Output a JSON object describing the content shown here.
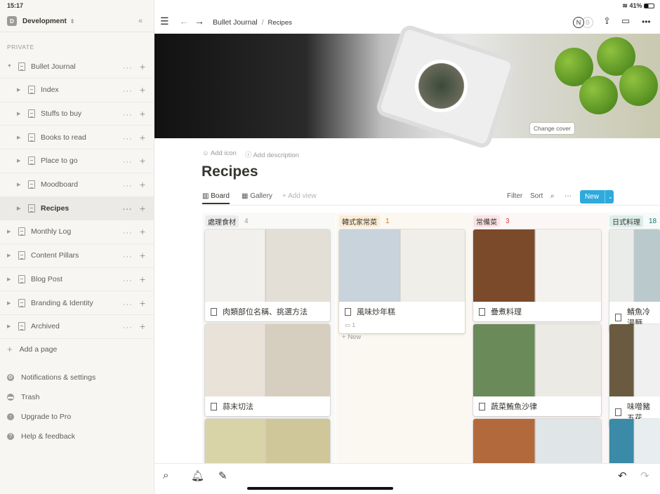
{
  "status": {
    "time": "15:17",
    "battery": "41%"
  },
  "workspace": {
    "name": "Development",
    "avatar": "D",
    "collapse_icon": "double-chevron-left-icon"
  },
  "sidebar": {
    "section": "PRIVATE",
    "items": [
      {
        "label": "Bullet Journal",
        "level": 0,
        "expanded": true
      },
      {
        "label": "Index",
        "level": 1
      },
      {
        "label": "Stuffs to buy",
        "level": 1
      },
      {
        "label": "Books to read",
        "level": 1
      },
      {
        "label": "Place to go",
        "level": 1
      },
      {
        "label": "Moodboard",
        "level": 1
      },
      {
        "label": "Recipes",
        "level": 1,
        "active": true
      },
      {
        "label": "Monthly Log",
        "level": 0
      },
      {
        "label": "Content Pillars",
        "level": 0
      },
      {
        "label": "Blog Post",
        "level": 0
      },
      {
        "label": "Branding & Identity",
        "level": 0
      },
      {
        "label": "Archived",
        "level": 0
      }
    ],
    "add_page": "Add a page",
    "bottom": [
      {
        "label": "Notifications & settings",
        "icon": "gear-icon"
      },
      {
        "label": "Trash",
        "icon": "trash-icon"
      },
      {
        "label": "Upgrade to Pro",
        "icon": "arrow-up-icon"
      },
      {
        "label": "Help & feedback",
        "icon": "question-icon"
      }
    ]
  },
  "header": {
    "breadcrumb": [
      "Bullet Journal",
      "Recipes"
    ],
    "avatars": [
      "N",
      "B"
    ]
  },
  "page": {
    "change_cover": "Change cover",
    "add_icon": "Add icon",
    "add_description": "Add description",
    "title": "Recipes"
  },
  "views": {
    "tabs": [
      "Board",
      "Gallery"
    ],
    "add_view": "Add view",
    "filter": "Filter",
    "sort": "Sort",
    "new": "New"
  },
  "board": {
    "add_new": "New",
    "columns": [
      {
        "name": "處理食材",
        "count": "4",
        "tag_bg": "#ebeced",
        "tag_color": "#37352f",
        "count_color": "#9b9a97",
        "bg": "#f9f9f8",
        "cards": [
          {
            "title": "肉類部位名稱、挑選方法"
          },
          {
            "title": "蒜末切法"
          },
          {
            "title": ""
          }
        ]
      },
      {
        "name": "韓式家常菜",
        "count": "1",
        "tag_bg": "#fbecd5",
        "tag_color": "#37352f",
        "count_color": "#d9730d",
        "bg": "#fbf8f1",
        "cards": [
          {
            "title": "風味炒年糕",
            "comments": "1"
          }
        ]
      },
      {
        "name": "常備菜",
        "count": "3",
        "tag_bg": "#fbe4e4",
        "tag_color": "#37352f",
        "count_color": "#e03e3e",
        "bg": "#fcf7f6",
        "cards": [
          {
            "title": "疊煮料理"
          },
          {
            "title": "蔬菜鮪魚沙律"
          },
          {
            "title": ""
          }
        ]
      },
      {
        "name": "日式料理",
        "count": "18",
        "tag_bg": "#ddedea",
        "tag_color": "#37352f",
        "count_color": "#0f7b6c",
        "bg": "#f6faf8",
        "cards": [
          {
            "title": "鯖魚冷湯麵"
          },
          {
            "title": "味噌豬五花"
          },
          {
            "title": ""
          }
        ]
      }
    ]
  }
}
